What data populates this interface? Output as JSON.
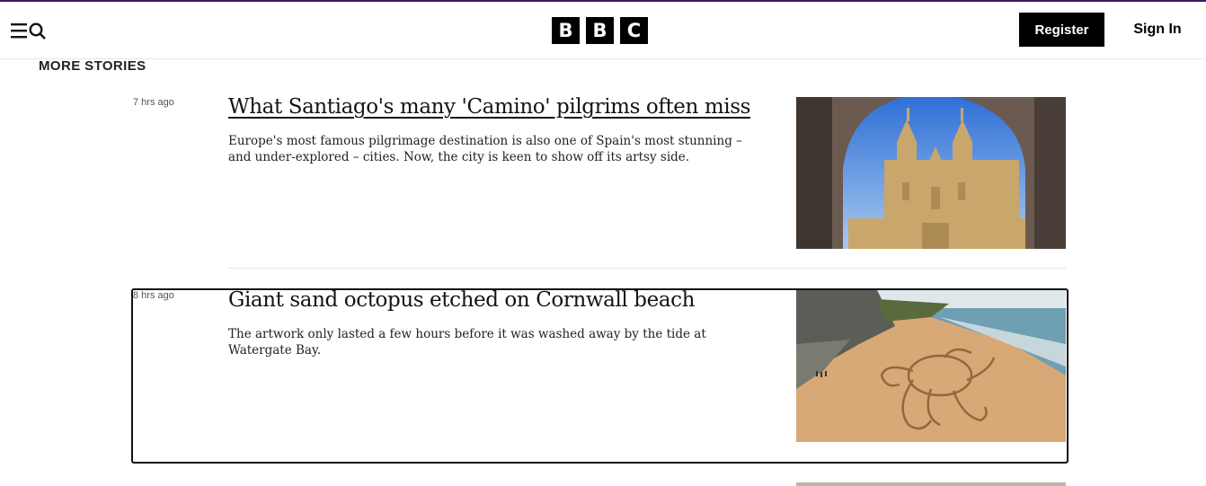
{
  "header": {
    "logo_letters": [
      "B",
      "B",
      "C"
    ],
    "register_label": "Register",
    "signin_label": "Sign In",
    "icons": {
      "menu": "menu-icon",
      "search": "search-icon"
    }
  },
  "section": {
    "title": "MORE STORIES"
  },
  "stories": [
    {
      "time": "7 hrs ago",
      "headline": "What Santiago's many 'Camino' pilgrims often miss",
      "summary": "Europe's most famous pilgrimage destination is also one of Spain's most stunning – and under-explored – cities. Now, the city is keen to show off its artsy side."
    },
    {
      "time": "8 hrs ago",
      "headline": "Giant sand octopus etched on Cornwall beach",
      "summary": "The artwork only lasted a few hours before it was washed away by the tide at Watergate Bay."
    }
  ],
  "colors": {
    "accent_topline": "#3a1c5c",
    "logo_bg": "#000000",
    "register_bg": "#000000"
  }
}
